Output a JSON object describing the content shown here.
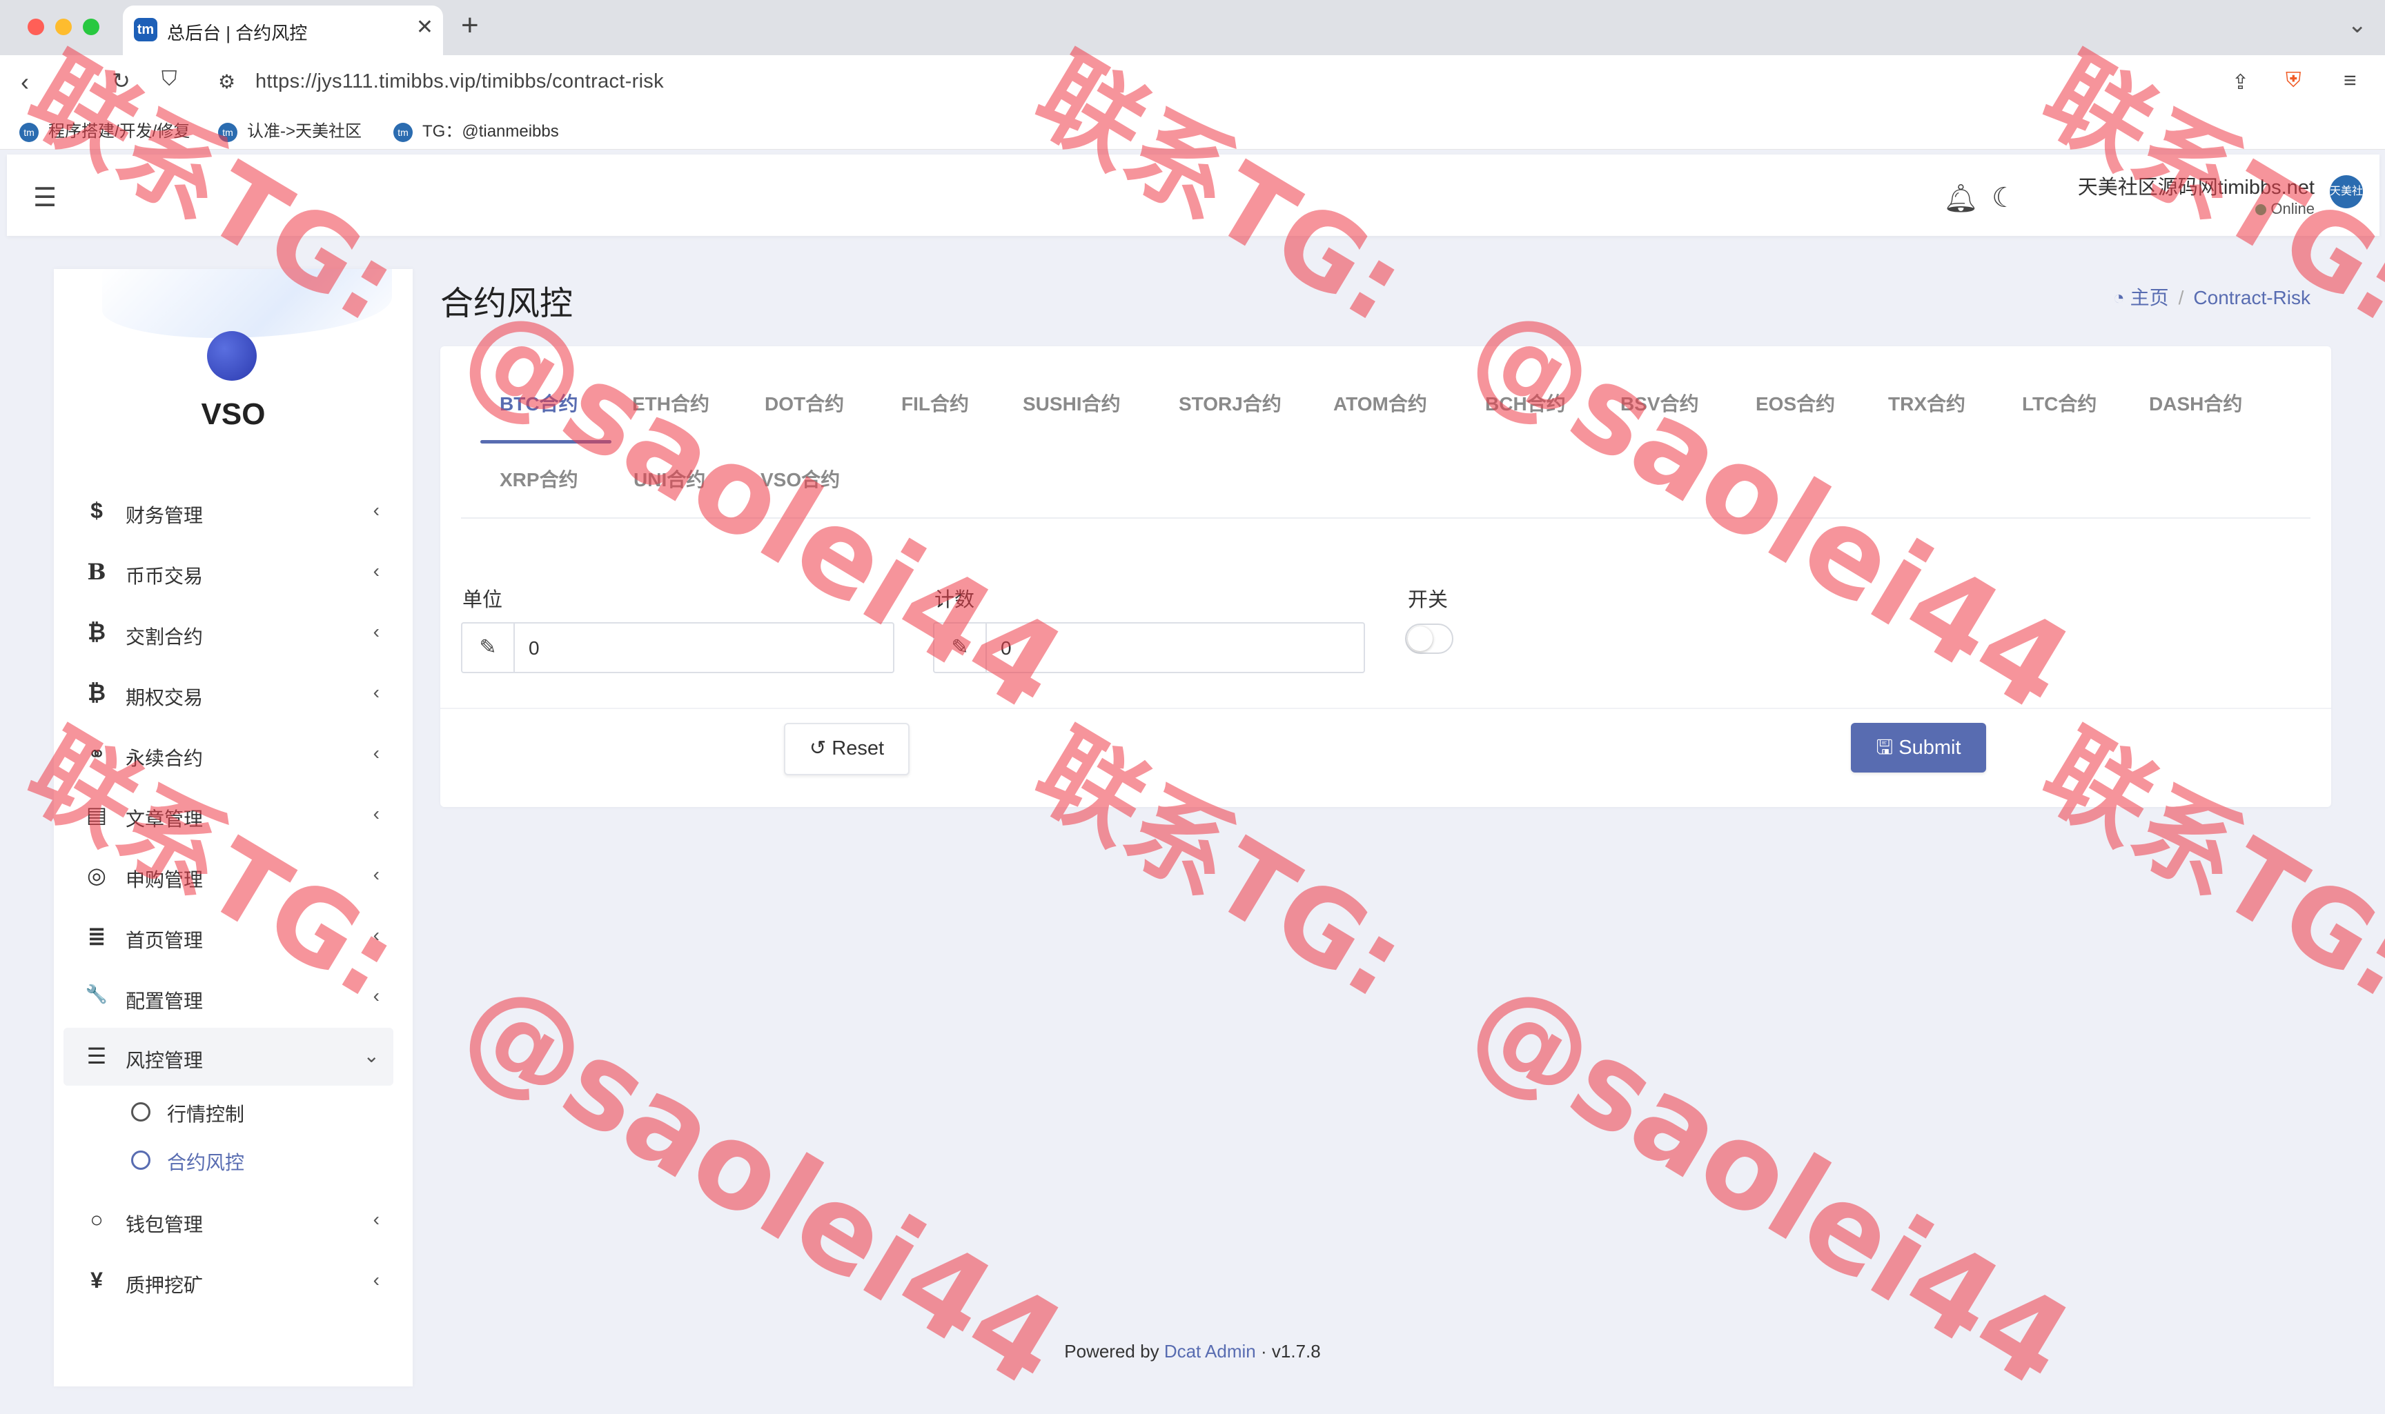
{
  "browser": {
    "tab_title": "总后台 | 合约风控",
    "tab_favicon": "tm",
    "url_host": "https://jys111.timibbs.vip",
    "url_path": "/timibbs/contract-risk",
    "bookmarks": [
      "程序搭建/开发/修复",
      "认准->天美社区",
      "TG：@tianmeibbs"
    ]
  },
  "header": {
    "user_name": "天美社区源码网timibbs.net",
    "status": "Online",
    "avatar_text": "天美社区"
  },
  "sidebar": {
    "brand": "VSO",
    "items": [
      {
        "icon": "dollar-icon",
        "glyph": "$",
        "label": "财务管理"
      },
      {
        "icon": "bitcoin-icon",
        "glyph": "B",
        "label": "币币交易"
      },
      {
        "icon": "btc-icon",
        "glyph": "₿",
        "label": "交割合约"
      },
      {
        "icon": "btc-icon",
        "glyph": "₿",
        "label": "期权交易"
      },
      {
        "icon": "link-icon",
        "glyph": "⚭",
        "label": "永续合约"
      },
      {
        "icon": "newspaper-icon",
        "glyph": "▤",
        "label": "文章管理"
      },
      {
        "icon": "lifering-icon",
        "glyph": "◎",
        "label": "申购管理"
      },
      {
        "icon": "list-icon",
        "glyph": "≣",
        "label": "首页管理"
      },
      {
        "icon": "wrench-icon",
        "glyph": "🔧",
        "label": "配置管理"
      },
      {
        "icon": "indent-icon",
        "glyph": "☰",
        "label": "风控管理"
      },
      {
        "icon": "circle-icon",
        "glyph": "○",
        "label": "钱包管理"
      },
      {
        "icon": "yen-icon",
        "glyph": "¥",
        "label": "质押挖矿"
      }
    ],
    "submenu": [
      "行情控制",
      "合约风控"
    ]
  },
  "page": {
    "title": "合约风控",
    "breadcrumb_home": "主页",
    "breadcrumb_current": "Contract-Risk"
  },
  "tabs": [
    "BTC合约",
    "ETH合约",
    "DOT合约",
    "FIL合约",
    "SUSHI合约",
    "STORJ合约",
    "ATOM合约",
    "BCH合约",
    "BSV合约",
    "EOS合约",
    "TRX合约",
    "LTC合约",
    "DASH合约",
    "XRP合约",
    "UNI合约",
    "VSO合约"
  ],
  "form": {
    "unit_label": "单位",
    "unit_value": "0",
    "count_label": "计数",
    "count_value": "0",
    "switch_label": "开关",
    "switch_on": false,
    "reset_label": "Reset",
    "submit_label": "Submit"
  },
  "footer": {
    "prefix": "Powered by",
    "link": "Dcat Admin",
    "version": "· v1.7.8"
  },
  "watermark": {
    "contact": "联系TG:",
    "handle": "@saolei44"
  },
  "colors": {
    "accent": "#586cb1",
    "watermark": "#ee3c48",
    "online": "#21b978"
  }
}
